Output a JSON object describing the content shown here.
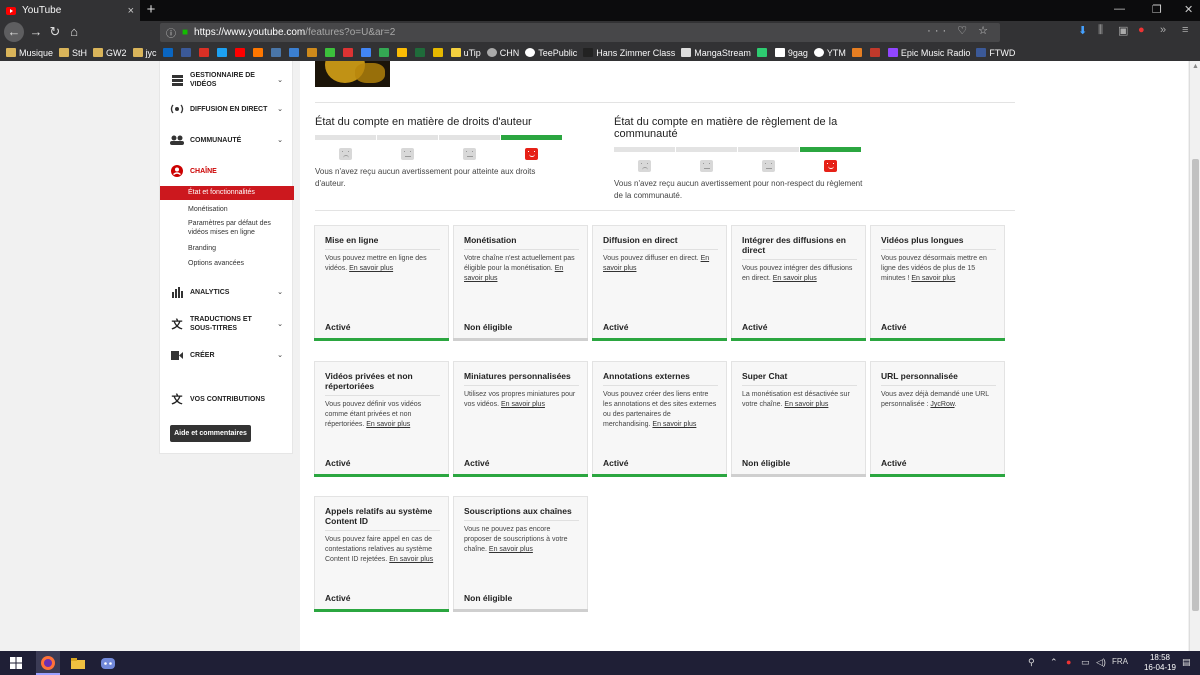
{
  "browser": {
    "tab_title": "YouTube",
    "tab_close": "×",
    "new_tab": "+",
    "url_host": "https://www.youtube.com",
    "url_rest": "/features?o=U&ar=2",
    "url_actions": "··· ♡ ☆"
  },
  "bookmarks": [
    "Musique",
    "StH",
    "GW2",
    "jyc",
    "uTip",
    "CHN",
    "TeePublic",
    "Hans Zimmer Class",
    "MangaStream",
    "9gag",
    "YTM",
    "Epic Music Radio",
    "FTWD"
  ],
  "sidebar": {
    "sections": [
      {
        "label": "GESTIONNAIRE DE VIDÉOS",
        "icon": "video-manager-icon"
      },
      {
        "label": "DIFFUSION EN DIRECT",
        "icon": "live-icon"
      },
      {
        "label": "COMMUNAUTÉ",
        "icon": "community-icon"
      },
      {
        "label": "CHAÎNE",
        "icon": "channel-icon"
      }
    ],
    "channel_items": [
      "État et fonctionnalités",
      "Monétisation",
      "Paramètres par défaut des vidéos mises en ligne",
      "Branding",
      "Options avancées"
    ],
    "sections2": [
      {
        "label": "ANALYTICS",
        "icon": "analytics-icon"
      },
      {
        "label": "TRADUCTIONS ET SOUS-TITRES",
        "icon": "translate-icon"
      },
      {
        "label": "CRÉER",
        "icon": "create-icon"
      }
    ],
    "contributions": "VOS CONTRIBUTIONS",
    "help_button": "Aide et commentaires"
  },
  "copyright": {
    "title": "État du compte en matière de droits d'auteur",
    "description": "Vous n'avez reçu aucun avertissement pour atteinte aux droits d'auteur.",
    "level": 4
  },
  "community": {
    "title": "État du compte en matière de règlement de la communauté",
    "description": "Vous n'avez reçu aucun avertissement pour non-respect du règlement de la communauté.",
    "level": 4
  },
  "features": [
    {
      "title": "Mise en ligne",
      "desc": "Vous pouvez mettre en ligne des vidéos.",
      "link": "En savoir plus",
      "status": "Activé",
      "enabled": true
    },
    {
      "title": "Monétisation",
      "desc": "Votre chaîne n'est actuellement pas éligible pour la monétisation.",
      "link": "En savoir plus",
      "status": "Non éligible",
      "enabled": false
    },
    {
      "title": "Diffusion en direct",
      "desc": "Vous pouvez diffuser en direct.",
      "link": "En savoir plus",
      "status": "Activé",
      "enabled": true
    },
    {
      "title": "Intégrer des diffusions en direct",
      "desc": "Vous pouvez intégrer des diffusions en direct.",
      "link": "En savoir plus",
      "status": "Activé",
      "enabled": true
    },
    {
      "title": "Vidéos plus longues",
      "desc": "Vous pouvez désormais mettre en ligne des vidéos de plus de 15 minutes !",
      "link": "En savoir plus",
      "status": "Activé",
      "enabled": true
    },
    {
      "title": "Vidéos privées et non répertoriées",
      "desc": "Vous pouvez définir vos vidéos comme étant privées et non répertoriées.",
      "link": "En savoir plus",
      "status": "Activé",
      "enabled": true
    },
    {
      "title": "Miniatures personnalisées",
      "desc": "Utilisez vos propres miniatures pour vos vidéos.",
      "link": "En savoir plus",
      "status": "Activé",
      "enabled": true
    },
    {
      "title": "Annotations externes",
      "desc": "Vous pouvez créer des liens entre les annotations et des sites externes ou des partenaires de merchandising.",
      "link": "En savoir plus",
      "status": "Activé",
      "enabled": true
    },
    {
      "title": "Super Chat",
      "desc": "La monétisation est désactivée sur votre chaîne.",
      "link": "En savoir plus",
      "status": "Non éligible",
      "enabled": false
    },
    {
      "title": "URL personnalisée",
      "desc": "Vous avez déjà demandé une URL personnalisée : ",
      "link": "JycRow",
      "suffix": ".",
      "status": "Activé",
      "enabled": true
    },
    {
      "title": "Appels relatifs au système Content ID",
      "desc": "Vous pouvez faire appel en cas de contestations relatives au système Content ID rejetées.",
      "link": "En savoir plus",
      "status": "Activé",
      "enabled": true
    },
    {
      "title": "Souscriptions aux chaînes",
      "desc": "Vous ne pouvez pas encore proposer de souscriptions à votre chaîne.",
      "link": "En savoir plus",
      "status": "Non éligible",
      "enabled": false
    }
  ],
  "taskbar": {
    "lang": "FRA",
    "time": "18:58",
    "date": "16-04-19"
  }
}
